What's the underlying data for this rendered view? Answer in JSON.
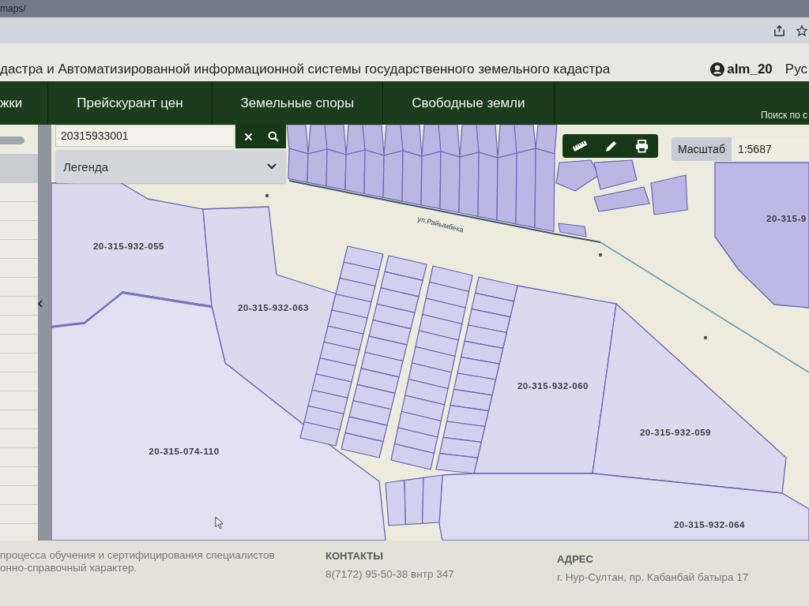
{
  "browser": {
    "url": "maps/"
  },
  "header": {
    "title": "дастра и Автоматизированной информационной системы государственного земельного кадастра",
    "user": "alm_20",
    "language": "Рус"
  },
  "nav": {
    "items": [
      "жки",
      "Прейскурант цен",
      "Земельные споры",
      "Свободные земли"
    ],
    "search_link": "Поиск по с"
  },
  "map": {
    "search": {
      "value": "20315933001"
    },
    "legend": {
      "label": "Легенда"
    },
    "scale": {
      "label": "Масштаб",
      "value": "1:5687"
    },
    "street_label": "ул.Райымбека",
    "parcels": [
      {
        "label": "20-315-9"
      },
      {
        "label": "20-315-932-055"
      },
      {
        "label": "20-315-932-063"
      },
      {
        "label": "20-315-932-060"
      },
      {
        "label": "20-315-932-059"
      },
      {
        "label": "20-315-074-110"
      },
      {
        "label": "20-315-932-064"
      }
    ]
  },
  "footer": {
    "about_lines": [
      "процесса обучения и сертифицирования специалистов",
      "онно-справочный характер."
    ],
    "contacts": {
      "heading": "КОНТАКТЫ",
      "phone": "8(7172) 95-50-38 внтр 347"
    },
    "address": {
      "heading": "АДРЕС",
      "text": "г. Нур-Султан, пр. Кабанбай батыра 17"
    }
  }
}
